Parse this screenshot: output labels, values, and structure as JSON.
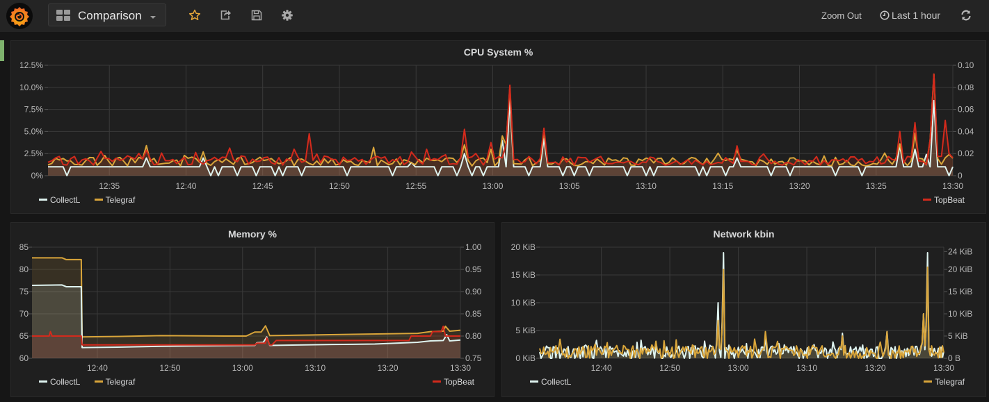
{
  "topbar": {
    "dashboard_title": "Comparison",
    "icons": {
      "logo": "grafana-logo-icon",
      "dashboards": "dashboard-grid-icon",
      "star": "star-icon",
      "share": "share-icon",
      "save": "save-icon",
      "settings": "gear-icon",
      "clock": "clock-icon",
      "refresh": "refresh-icon"
    },
    "zoom_out_label": "Zoom Out",
    "time_range_label": "Last 1 hour"
  },
  "colors": {
    "CollectL": "#dff4f0",
    "Telegraf": "#d9a53a",
    "TopBeat": "#d42a1c",
    "row_marker": "#7eb26d",
    "star": "#e8a83a"
  },
  "chart_data": [
    {
      "id": "cpu",
      "type": "area",
      "title": "CPU System %",
      "x_range": [
        "12:31",
        "13:30"
      ],
      "x_ticks": [
        "12:35",
        "12:40",
        "12:45",
        "12:50",
        "12:55",
        "13:00",
        "13:05",
        "13:10",
        "13:15",
        "13:20",
        "13:25",
        "13:30"
      ],
      "y_left": {
        "range": [
          0,
          12.5
        ],
        "ticks": [
          "0%",
          "2.5%",
          "5.0%",
          "7.5%",
          "10.0%",
          "12.5%"
        ]
      },
      "y_right": {
        "range": [
          0,
          0.1
        ],
        "ticks": [
          "0",
          "0.02",
          "0.04",
          "0.06",
          "0.08",
          "0.10"
        ]
      },
      "grid": true,
      "legend_left": [
        "CollectL",
        "Telegraf"
      ],
      "legend_right": [
        "TopBeat"
      ],
      "series": [
        {
          "name": "CollectL",
          "axis": "left",
          "baseline": 1.0,
          "dips": [
            0.02,
            0.18,
            0.19,
            0.21,
            0.23,
            0.25,
            0.26,
            0.28,
            0.33,
            0.38,
            0.4,
            0.43,
            0.45,
            0.47,
            0.48,
            0.5,
            0.51,
            0.53,
            0.55,
            0.57,
            0.58,
            0.6,
            0.64,
            0.66,
            0.67,
            0.72,
            0.73,
            0.75,
            0.76,
            0.8,
            0.82,
            0.87,
            0.9,
            0.98,
            0.995
          ],
          "peaks": [
            [
              0.11,
              2.0
            ],
            [
              0.17,
              2.0
            ],
            [
              0.4,
              1.5
            ],
            [
              0.46,
              2.5
            ],
            [
              0.5,
              4.0
            ],
            [
              0.51,
              8.5
            ],
            [
              0.55,
              4.2
            ],
            [
              0.76,
              2.0
            ],
            [
              0.96,
              3.0
            ],
            [
              0.98,
              8.5
            ],
            [
              0.97,
              2.4
            ],
            [
              0.94,
              3.4
            ]
          ]
        },
        {
          "name": "Telegraf",
          "axis": "left",
          "level": 1.6,
          "noise": 0.5,
          "peaks": [
            [
              0.11,
              3.4
            ],
            [
              0.17,
              2.7
            ],
            [
              0.36,
              3.2
            ],
            [
              0.46,
              3.5
            ],
            [
              0.49,
              3.0
            ],
            [
              0.5,
              4.5
            ],
            [
              0.51,
              10.0
            ],
            [
              0.55,
              5.0
            ],
            [
              0.76,
              2.9
            ],
            [
              0.94,
              3.6
            ],
            [
              0.96,
              4.8
            ],
            [
              0.98,
              11.5
            ],
            [
              0.997,
              2.4
            ]
          ]
        },
        {
          "name": "TopBeat",
          "axis": "right",
          "level": 0.0135,
          "noise": 0.004,
          "peaks": [
            [
              0.06,
              0.022
            ],
            [
              0.11,
              0.023
            ],
            [
              0.2,
              0.025
            ],
            [
              0.27,
              0.024
            ],
            [
              0.29,
              0.038
            ],
            [
              0.42,
              0.024
            ],
            [
              0.46,
              0.042
            ],
            [
              0.49,
              0.03
            ],
            [
              0.51,
              0.082
            ],
            [
              0.55,
              0.043
            ],
            [
              0.76,
              0.027
            ],
            [
              0.94,
              0.04
            ],
            [
              0.96,
              0.048
            ],
            [
              0.98,
              0.092
            ],
            [
              0.99,
              0.05
            ],
            [
              0.997,
              0.02
            ]
          ]
        }
      ]
    },
    {
      "id": "memory",
      "type": "area",
      "title": "Memory %",
      "x_range": [
        "12:31",
        "13:30"
      ],
      "x_ticks": [
        "12:40",
        "12:50",
        "13:00",
        "13:10",
        "13:20",
        "13:30"
      ],
      "y_left": {
        "range": [
          60,
          85
        ],
        "ticks": [
          "60",
          "65",
          "70",
          "75",
          "80",
          "85"
        ]
      },
      "y_right": {
        "range": [
          0.75,
          1.0
        ],
        "ticks": [
          "0.75",
          "0.80",
          "0.85",
          "0.90",
          "0.95",
          "1.00"
        ]
      },
      "grid": true,
      "legend_left": [
        "CollectL",
        "Telegraf"
      ],
      "legend_right": [
        "TopBeat"
      ],
      "series": [
        {
          "name": "Telegraf",
          "axis": "left",
          "points": [
            [
              0,
              82.6
            ],
            [
              0.07,
              82.6
            ],
            [
              0.08,
              82.2
            ],
            [
              0.115,
              82.2
            ],
            [
              0.117,
              64.8
            ],
            [
              0.2,
              64.9
            ],
            [
              0.3,
              65.1
            ],
            [
              0.45,
              65.0
            ],
            [
              0.5,
              65.0
            ],
            [
              0.52,
              65.9
            ],
            [
              0.535,
              65.9
            ],
            [
              0.545,
              67.3
            ],
            [
              0.555,
              65.1
            ],
            [
              0.75,
              65.4
            ],
            [
              0.9,
              65.6
            ],
            [
              0.93,
              66.0
            ],
            [
              0.96,
              66.1
            ],
            [
              0.965,
              67.2
            ],
            [
              0.975,
              66.1
            ],
            [
              1.0,
              66.3
            ]
          ]
        },
        {
          "name": "CollectL",
          "axis": "left",
          "points": [
            [
              0,
              76.4
            ],
            [
              0.07,
              76.5
            ],
            [
              0.08,
              76.1
            ],
            [
              0.115,
              76.1
            ],
            [
              0.117,
              62.4
            ],
            [
              0.2,
              62.5
            ],
            [
              0.3,
              62.7
            ],
            [
              0.52,
              62.9
            ],
            [
              0.525,
              63.5
            ],
            [
              0.54,
              63.6
            ],
            [
              0.548,
              64.8
            ],
            [
              0.555,
              62.9
            ],
            [
              0.7,
              63.1
            ],
            [
              0.8,
              63.2
            ],
            [
              0.9,
              63.6
            ],
            [
              0.93,
              63.9
            ],
            [
              0.96,
              64.0
            ],
            [
              0.968,
              65.3
            ],
            [
              0.975,
              63.9
            ],
            [
              1.0,
              64.1
            ]
          ]
        },
        {
          "name": "TopBeat",
          "axis": "right",
          "points": [
            [
              0,
              0.8
            ],
            [
              0.04,
              0.8
            ],
            [
              0.043,
              0.81
            ],
            [
              0.047,
              0.8
            ],
            [
              0.115,
              0.8
            ],
            [
              0.117,
              0.78
            ],
            [
              0.52,
              0.78
            ],
            [
              0.525,
              0.784
            ],
            [
              0.545,
              0.784
            ],
            [
              0.548,
              0.796
            ],
            [
              0.555,
              0.78
            ],
            [
              0.56,
              0.78
            ],
            [
              0.57,
              0.79
            ],
            [
              0.88,
              0.79
            ],
            [
              0.885,
              0.8
            ],
            [
              0.93,
              0.8
            ],
            [
              0.935,
              0.81
            ],
            [
              0.955,
              0.81
            ],
            [
              0.96,
              0.822
            ],
            [
              0.965,
              0.8
            ],
            [
              1.0,
              0.8
            ]
          ]
        }
      ]
    },
    {
      "id": "network",
      "type": "area",
      "title": "Network kbin",
      "x_range": [
        "12:31",
        "13:30"
      ],
      "x_ticks": [
        "12:40",
        "12:50",
        "13:00",
        "13:10",
        "13:20",
        "13:30"
      ],
      "y_left": {
        "range": [
          0,
          20
        ],
        "unit": "KiB",
        "ticks": [
          "0 KiB",
          "5 KiB",
          "10 KiB",
          "15 KiB",
          "20 KiB"
        ]
      },
      "y_right": {
        "range": [
          0,
          25
        ],
        "unit": "KiB",
        "ticks": [
          "0 B",
          "5 KiB",
          "10 KiB",
          "15 KiB",
          "20 KiB",
          "24 KiB"
        ]
      },
      "grid": true,
      "legend_left": [
        "CollectL"
      ],
      "legend_right": [
        "Telegraf"
      ],
      "series": [
        {
          "name": "CollectL",
          "axis": "left",
          "level": 1.0,
          "noise": 1.2,
          "peaks": [
            [
              0.44,
              10.0
            ],
            [
              0.455,
              19.0
            ],
            [
              0.56,
              4.0
            ],
            [
              0.75,
              4.5
            ],
            [
              0.86,
              4.8
            ],
            [
              0.95,
              8.0
            ],
            [
              0.96,
              19.0
            ]
          ]
        },
        {
          "name": "Telegraf",
          "axis": "right",
          "level": 1.4,
          "noise": 1.5,
          "peaks": [
            [
              0.44,
              8.5
            ],
            [
              0.455,
              20.0
            ],
            [
              0.56,
              6.0
            ],
            [
              0.75,
              5.0
            ],
            [
              0.86,
              6.0
            ],
            [
              0.95,
              10.0
            ],
            [
              0.96,
              20.5
            ]
          ]
        }
      ]
    }
  ]
}
